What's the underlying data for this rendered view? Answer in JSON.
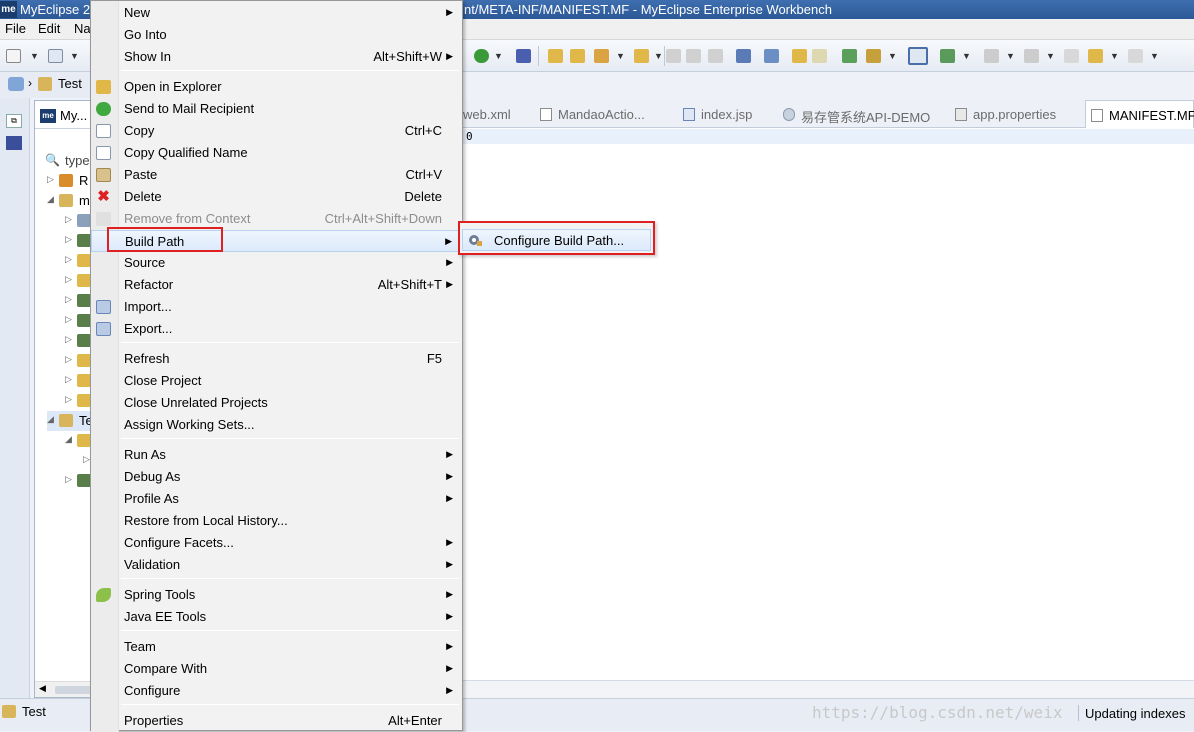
{
  "window": {
    "logo": "me",
    "title_left": "MyEclipse 20",
    "title_right": "nt/META-INF/MANIFEST.MF - MyEclipse Enterprise Workbench"
  },
  "menubar": [
    "File",
    "Edit",
    "Na"
  ],
  "breadcrumb": {
    "label": "Test"
  },
  "explorer": {
    "tab_logo": "me",
    "tab_label": "My...",
    "filter_placeholder": "type",
    "tree": [
      "R",
      "m",
      "",
      "",
      "",
      "",
      "",
      "",
      "",
      "",
      "",
      "",
      "",
      "Te",
      "",
      "",
      ""
    ]
  },
  "editor": {
    "tabs": [
      "web.xml",
      "MandaoActio...",
      "index.jsp",
      "易存管系统API-DEMO",
      "app.properties",
      "MANIFEST.MF"
    ],
    "line_text": "0"
  },
  "context_menu": {
    "items": [
      {
        "label": "New",
        "accel": ""
      },
      {
        "label": "Go Into",
        "accel": ""
      },
      {
        "label": "Show In",
        "accel": "Alt+Shift+W"
      },
      {
        "label": "Open in Explorer",
        "accel": ""
      },
      {
        "label": "Send to Mail Recipient",
        "accel": ""
      },
      {
        "label": "Copy",
        "accel": "Ctrl+C"
      },
      {
        "label": "Copy Qualified Name",
        "accel": ""
      },
      {
        "label": "Paste",
        "accel": "Ctrl+V"
      },
      {
        "label": "Delete",
        "accel": "Delete"
      },
      {
        "label": "Remove from Context",
        "accel": "Ctrl+Alt+Shift+Down"
      },
      {
        "label": "Build Path",
        "accel": ""
      },
      {
        "label": "Source",
        "accel": ""
      },
      {
        "label": "Refactor",
        "accel": "Alt+Shift+T"
      },
      {
        "label": "Import...",
        "accel": ""
      },
      {
        "label": "Export...",
        "accel": ""
      },
      {
        "label": "Refresh",
        "accel": "F5"
      },
      {
        "label": "Close Project",
        "accel": ""
      },
      {
        "label": "Close Unrelated Projects",
        "accel": ""
      },
      {
        "label": "Assign Working Sets...",
        "accel": ""
      },
      {
        "label": "Run As",
        "accel": ""
      },
      {
        "label": "Debug As",
        "accel": ""
      },
      {
        "label": "Profile As",
        "accel": ""
      },
      {
        "label": "Restore from Local History...",
        "accel": ""
      },
      {
        "label": "Configure Facets...",
        "accel": ""
      },
      {
        "label": "Validation",
        "accel": ""
      },
      {
        "label": "Spring Tools",
        "accel": ""
      },
      {
        "label": "Java EE Tools",
        "accel": ""
      },
      {
        "label": "Team",
        "accel": ""
      },
      {
        "label": "Compare With",
        "accel": ""
      },
      {
        "label": "Configure",
        "accel": ""
      },
      {
        "label": "Properties",
        "accel": "Alt+Enter"
      }
    ]
  },
  "submenu": {
    "item": "Configure Build Path..."
  },
  "status": {
    "project": "Test",
    "watermark": "https://blog.csdn.net/weix",
    "progress": "Updating indexes"
  },
  "colors": {
    "highlight_box": "#e02020",
    "title_bar": "#2c5896"
  }
}
